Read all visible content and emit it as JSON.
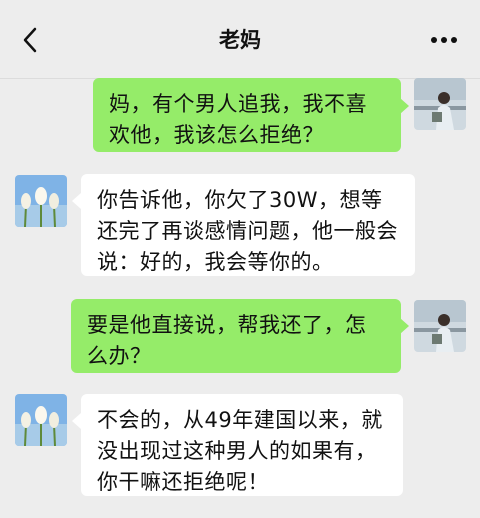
{
  "header": {
    "title": "老妈",
    "back_icon": "chevron-left-icon",
    "more_icon": "more-dots-icon"
  },
  "messages": [
    {
      "sender": "me",
      "text": "妈，有个男人追我，我不喜欢他，我该怎么拒绝？"
    },
    {
      "sender": "mom",
      "text": "你告诉他，你欠了30W，想等还完了再谈感情问题，他一般会说：好的，我会等你的。"
    },
    {
      "sender": "me",
      "text": "要是他直接说，帮我还了，怎么办？"
    },
    {
      "sender": "mom",
      "text": "不会的，从49年建国以来，就没出现过这种男人的如果有，你干嘛还拒绝呢！"
    }
  ],
  "colors": {
    "background": "#ededed",
    "my_bubble": "#95ec69",
    "other_bubble": "#ffffff"
  }
}
